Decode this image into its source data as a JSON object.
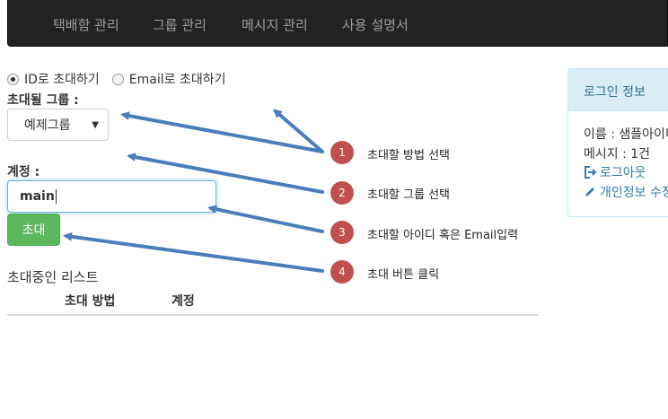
{
  "nav": {
    "items": [
      "택배함 관리",
      "그룹 관리",
      "메시지 관리",
      "사용 설명서"
    ]
  },
  "invite_method": {
    "options": [
      "ID로 초대하기",
      "Email로 초대하기"
    ],
    "selected": "ID로 초대하기"
  },
  "group_field": {
    "label": "초대될 그룹 :",
    "value": "예제그룹"
  },
  "account_field": {
    "label": "계정 :",
    "value": "main"
  },
  "invite_button": {
    "label": "초대"
  },
  "invite_list": {
    "title": "초대중인 리스트",
    "columns": [
      "초대 방법",
      "계정"
    ]
  },
  "login_panel": {
    "title": "로그인 정보",
    "name_line": "이름 : 샘플아이디",
    "message_line": "메시지 : 1건",
    "logout_label": "로그아웃",
    "profile_label": "개인정보 수정"
  },
  "annotations": [
    {
      "number": "1",
      "text": "초대할 방법 선택"
    },
    {
      "number": "2",
      "text": "초대할 그룹 선택"
    },
    {
      "number": "3",
      "text": "초대할 아이디 혹은 Email입력"
    },
    {
      "number": "4",
      "text": "초대 버튼 클릭"
    }
  ],
  "colors": {
    "navbar": "#222222",
    "nav_text": "#9d9d9d",
    "success_button": "#5cb85c",
    "input_focus": "#66afe9",
    "panel_heading": "#d9edf7",
    "panel_heading_text": "#31708f",
    "link": "#337ab7",
    "arrow": "#4a7ebb",
    "badge": "#c0504d"
  },
  "icons": [
    "logout-icon",
    "pencil-icon",
    "caret-down-icon"
  ]
}
